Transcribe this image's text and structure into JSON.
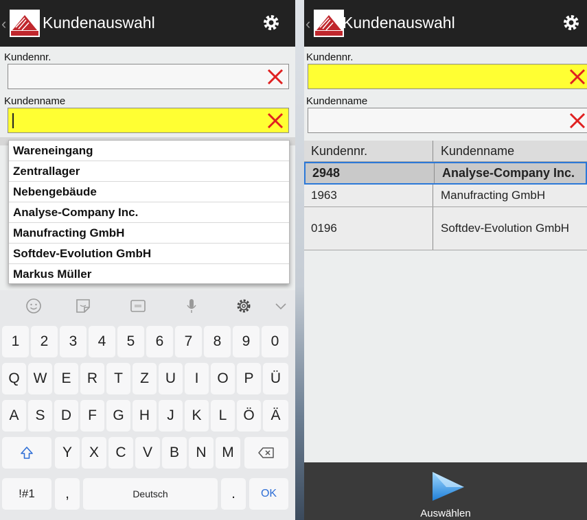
{
  "left_screen": {
    "title": "Kundenauswahl",
    "customer_no_label": "Kundennr.",
    "customer_no_value": "",
    "customer_name_label": "Kundenname",
    "customer_name_value": "",
    "suggestions": [
      "Wareneingang",
      "Zentrallager",
      "Nebengebäude",
      "Analyse-Company Inc.",
      "Manufracting GmbH",
      "Softdev-Evolution GmbH",
      "Markus Müller"
    ],
    "keyboard": {
      "number_row": [
        "1",
        "2",
        "3",
        "4",
        "5",
        "6",
        "7",
        "8",
        "9",
        "0"
      ],
      "row1": [
        "Q",
        "W",
        "E",
        "R",
        "T",
        "Z",
        "U",
        "I",
        "O",
        "P",
        "Ü"
      ],
      "row2": [
        "A",
        "S",
        "D",
        "F",
        "G",
        "H",
        "J",
        "K",
        "L",
        "Ö",
        "Ä"
      ],
      "row3": [
        "Y",
        "X",
        "C",
        "V",
        "B",
        "N",
        "M"
      ],
      "symbols_key": "!#1",
      "comma_key": ",",
      "space_label": "Deutsch",
      "period_key": ".",
      "ok_key": "OK"
    }
  },
  "right_screen": {
    "title": "Kundenauswahl",
    "customer_no_label": "Kundennr.",
    "customer_name_label": "Kundenname",
    "table": {
      "headers": [
        "Kundennr.",
        "Kundenname"
      ],
      "rows": [
        {
          "no": "2948",
          "name": "Analyse-Company Inc."
        },
        {
          "no": "1963",
          "name": "Manufracting GmbH"
        },
        {
          "no": "0196",
          "name": "Softdev-Evolution GmbH"
        }
      ],
      "selected_row": 0
    },
    "select_button_label": "Auswählen"
  },
  "colors": {
    "appbar": "#222222",
    "highlight_field": "#ffff33",
    "clear_x": "#e02020",
    "selection_border": "#2b78d8",
    "bottombar": "#3a3a3a"
  }
}
